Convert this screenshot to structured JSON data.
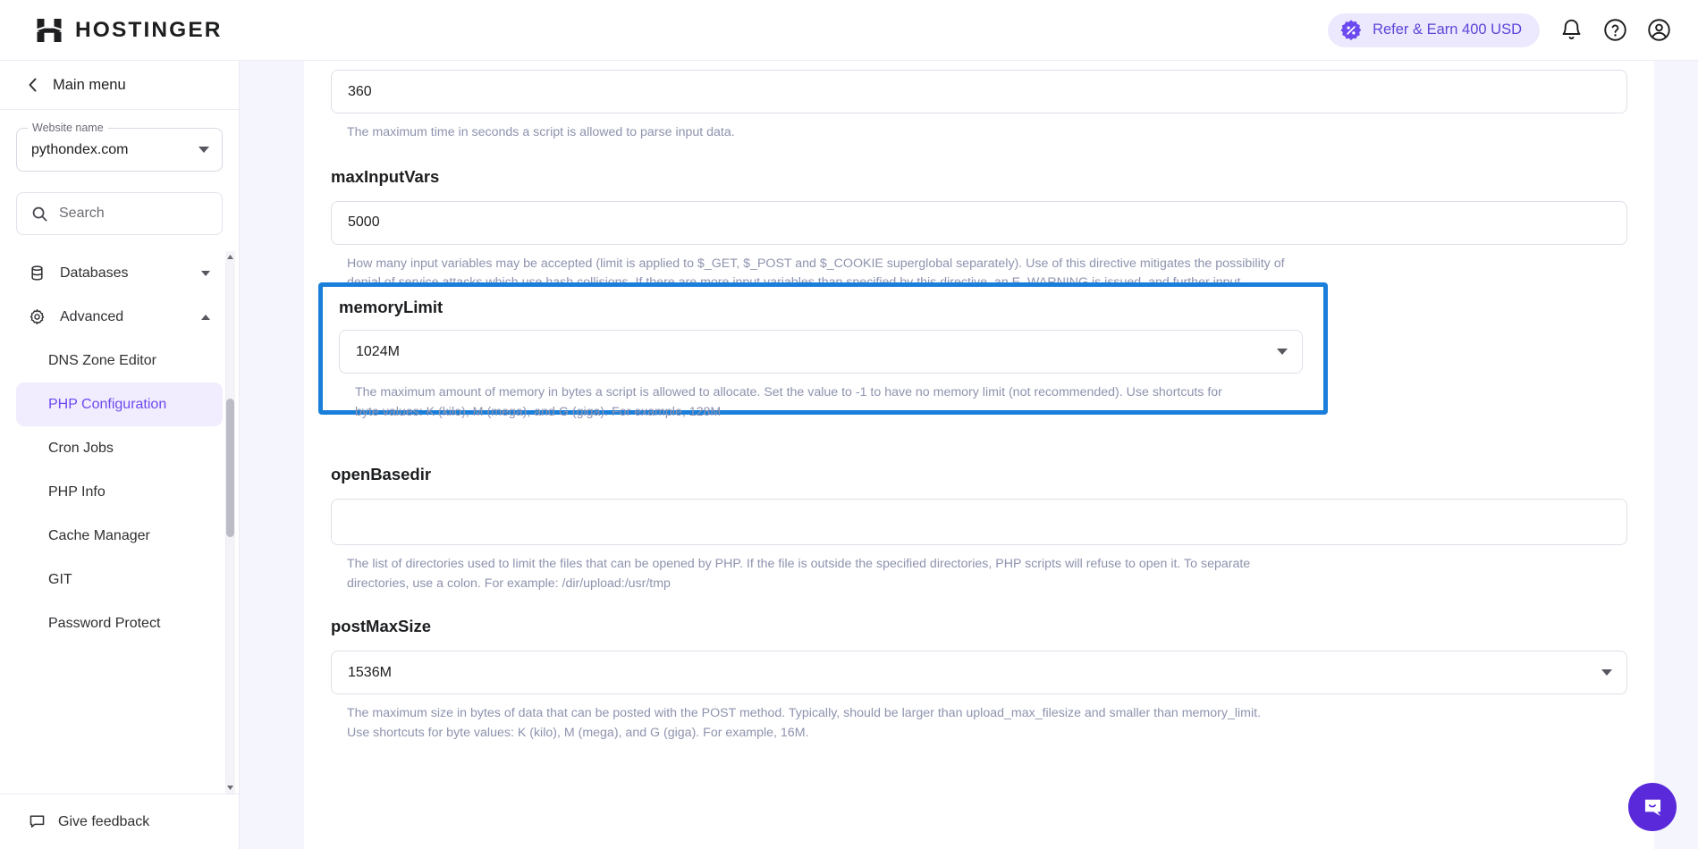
{
  "header": {
    "brand": "HOSTINGER",
    "refer_label": "Refer & Earn 400 USD",
    "icons": {
      "refer_badge": "discount-badge-icon",
      "notifications": "bell-icon",
      "help": "question-circle-icon",
      "account": "user-circle-icon"
    },
    "accent_purple": "#5c45d8",
    "pill_background": "#ece9fe"
  },
  "sidebar": {
    "back_label": "Main menu",
    "website_field": {
      "legend": "Website name",
      "value": "pythondex.com"
    },
    "search": {
      "placeholder": "Search"
    },
    "groups": [
      {
        "label": "Databases",
        "icon": "database-icon",
        "expanded": false
      },
      {
        "label": "Advanced",
        "icon": "gear-icon",
        "expanded": true
      }
    ],
    "advanced_items": [
      {
        "label": "DNS Zone Editor",
        "active": false
      },
      {
        "label": "PHP Configuration",
        "active": true
      },
      {
        "label": "Cron Jobs",
        "active": false
      },
      {
        "label": "PHP Info",
        "active": false
      },
      {
        "label": "Cache Manager",
        "active": false
      },
      {
        "label": "GIT",
        "active": false
      },
      {
        "label": "Password Protect",
        "active": false
      }
    ],
    "footer": {
      "label": "Give feedback",
      "icon": "comment-icon"
    },
    "active_color": "#6d49f0",
    "active_background": "#f1edfe"
  },
  "main": {
    "highlight_color": "#1a7fdb",
    "fields": [
      {
        "name": "maxInputTime",
        "title": "",
        "value": "360",
        "type": "text",
        "help": "The maximum time in seconds a script is allowed to parse input data."
      },
      {
        "name": "maxInputVars",
        "title": "maxInputVars",
        "value": "5000",
        "type": "text",
        "help": "How many input variables may be accepted (limit is applied to $_GET, $_POST and $_COOKIE superglobal separately). Use of this directive mitigates the possibility of denial of service attacks which use hash collisions. If there are more input variables than specified by this directive, an E_WARNING is issued, and further input variables are truncated from the request."
      },
      {
        "name": "memoryLimit",
        "title": "memoryLimit",
        "value": "1024M",
        "type": "select",
        "highlighted": true,
        "help": "The maximum amount of memory in bytes a script is allowed to allocate. Set the value to -1 to have no memory limit (not recommended). Use shortcuts for byte values: K (kilo), M (mega), and G (giga). For example, 128M"
      },
      {
        "name": "openBasedir",
        "title": "openBasedir",
        "value": "",
        "type": "text",
        "help": "The list of directories used to limit the files that can be opened by PHP. If the file is outside the specified directories, PHP scripts will refuse to open it. To separate directories, use a colon. For example: /dir/upload:/usr/tmp"
      },
      {
        "name": "postMaxSize",
        "title": "postMaxSize",
        "value": "1536M",
        "type": "select",
        "help": "The maximum size in bytes of data that can be posted with the POST method. Typically, should be larger than upload_max_filesize and smaller than memory_limit. Use shortcuts for byte values: K (kilo), M (mega), and G (giga). For example, 16M."
      }
    ]
  },
  "chat": {
    "icon": "chat-bubble-icon",
    "color": "#5a29d9"
  }
}
